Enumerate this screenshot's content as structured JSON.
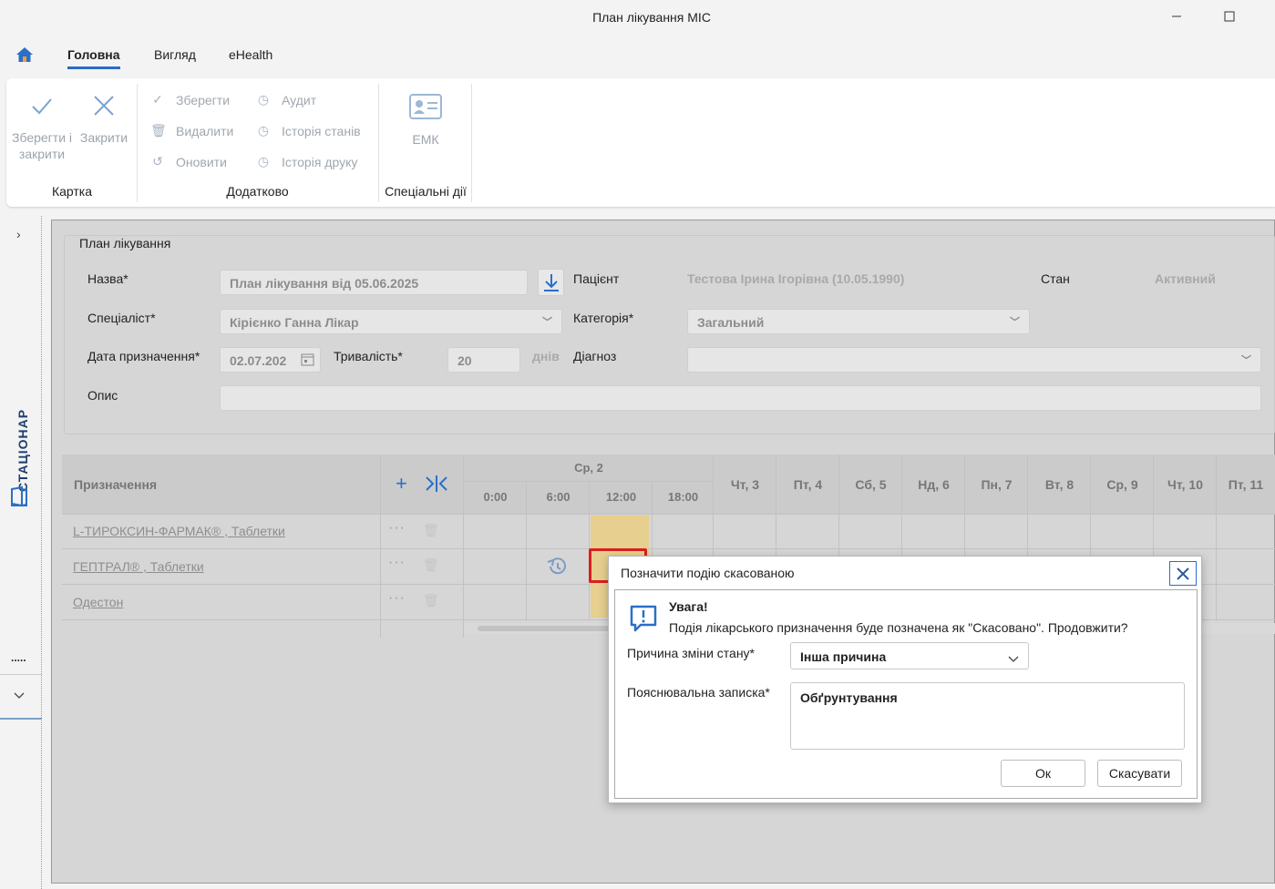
{
  "window": {
    "title": "План лікування МІС",
    "minimize_icon": "minimize-icon",
    "maximize_icon": "maximize-icon"
  },
  "menu": {
    "home_icon": "home-icon",
    "tabs": [
      "Головна",
      "Вигляд",
      "eHealth"
    ],
    "active_tab": "Головна"
  },
  "ribbon": {
    "save_close": "Зберегти і закрити",
    "close": "Закрити",
    "save": "Зберегти",
    "delete": "Видалити",
    "refresh": "Оновити",
    "audit": "Аудит",
    "state_history": "Історія станів",
    "print_history": "Історія друку",
    "emk": "ЕМК",
    "groups": [
      "Картка",
      "Додатково",
      "Спеціальні дії"
    ]
  },
  "side_panel": {
    "label": "СТАЦІОНАР",
    "more": ".....",
    "expand_icon": "chevron-right-icon",
    "collapse_icon": "chevron-down-icon"
  },
  "form": {
    "legend": "План лікування",
    "name_label": "Назва*",
    "name_value": "План лікування від 05.06.2025",
    "patient_label": "Пацієнт",
    "patient_value": "Тестова Ірина Ігорівна (10.05.1990)",
    "state_label": "Стан",
    "state_value": "Активний",
    "specialist_label": "Спеціаліст*",
    "specialist_value": "Кірієнко Ганна Лікар",
    "category_label": "Категорія*",
    "category_value": "Загальний",
    "date_label": "Дата призначення*",
    "date_value": "02.07.202",
    "duration_label": "Тривалість*",
    "duration_value": "20",
    "duration_unit": "днів",
    "diagnosis_label": "Діагноз",
    "diagnosis_value": "",
    "description_label": "Опис",
    "description_value": ""
  },
  "grid": {
    "header_label": "Призначення",
    "day_group": "Ср, 2",
    "hours": [
      "0:00",
      "6:00",
      "12:00",
      "18:00"
    ],
    "days": [
      "Чт, 3",
      "Пт, 4",
      "Сб, 5",
      "Нд, 6",
      "Пн, 7",
      "Вт, 8",
      "Ср, 9",
      "Чт, 10",
      "Пт, 11"
    ],
    "rows": [
      "L-ТИРОКСИН-ФАРМАК® , Таблетки",
      "ГЕПТРАЛ® , Таблетки",
      "Одестон"
    ],
    "event_color": "#e6cf8f",
    "highlight_color": "#d91f1f"
  },
  "dialog": {
    "title": "Позначити подію скасованою",
    "warning_title": "Увага!",
    "warning_text": "Подія лікарського призначення буде позначена як \"Скасовано\". Продовжити?",
    "reason_label": "Причина зміни стану*",
    "reason_value": "Інша причина",
    "note_label": "Пояснювальна записка*",
    "note_value": "Обґрунтування",
    "ok": "Ок",
    "cancel": "Скасувати"
  }
}
